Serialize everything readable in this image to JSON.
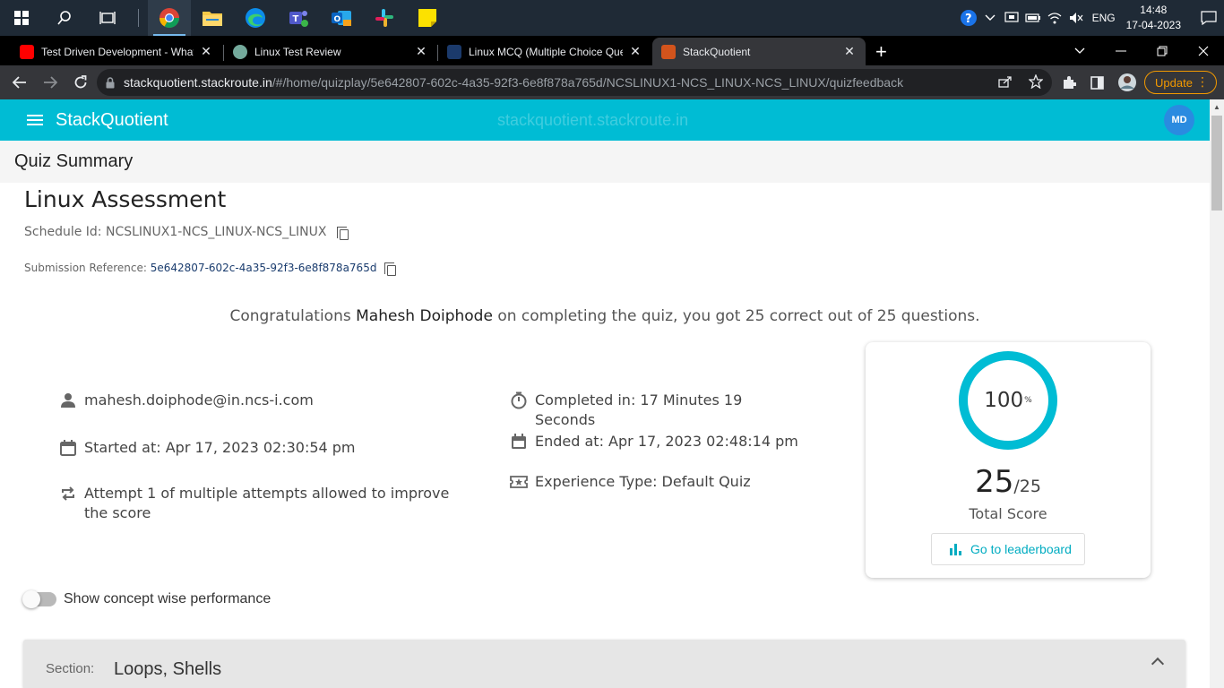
{
  "taskbar": {
    "apps": [
      "chrome",
      "file-explorer",
      "edge",
      "teams",
      "outlook",
      "slack",
      "sticky-notes"
    ],
    "tray": {
      "language": "ENG",
      "time": "14:48",
      "date": "17-04-2023"
    }
  },
  "browser": {
    "tabs": [
      {
        "title": "Test Driven Development - What",
        "icon": "youtube-icon",
        "active": false
      },
      {
        "title": "Linux Test Review",
        "icon": "chatgpt-icon",
        "active": false
      },
      {
        "title": "Linux MCQ (Multiple Choice Que",
        "icon": "sanfoundry-icon",
        "active": false
      },
      {
        "title": "StackQuotient",
        "icon": "stackquotient-icon",
        "active": true
      }
    ],
    "url_host": "stackquotient.stackroute.in",
    "url_path": "/#/home/quizplay/5e642807-602c-4a35-92f3-6e8f878a765d/NCSLINUX1-NCS_LINUX-NCS_LINUX/quizfeedback",
    "update_label": "Update"
  },
  "app": {
    "brand": "StackQuotient",
    "watermark": "stackquotient.stackroute.in",
    "avatar": "MD",
    "accent": "#00bcd4"
  },
  "page": {
    "subheader": "Quiz Summary",
    "title": "Linux Assessment",
    "schedule_label": "Schedule Id: ",
    "schedule_id": "NCSLINUX1-NCS_LINUX-NCS_LINUX",
    "submission_label": "Submission Reference: ",
    "submission_ref": "5e642807-602c-4a35-92f3-6e8f878a765d",
    "congrats_prefix": "Congratulations ",
    "user_name": "Mahesh Doiphode",
    "congrats_suffix": " on completing the quiz, you got 25 correct out of 25 questions."
  },
  "details": {
    "email": "mahesh.doiphode@in.ncs-i.com",
    "started": "Started at: Apr 17, 2023 02:30:54 pm",
    "attempt": "Attempt 1 of multiple attempts allowed to improve the score",
    "completed": "Completed in: 17 Minutes 19 Seconds",
    "ended": "Ended at: Apr 17, 2023 02:48:14 pm",
    "experience": "Experience Type: Default Quiz"
  },
  "score": {
    "percent": "100",
    "percent_sign": "%",
    "correct": "25",
    "total": "/25",
    "label": "Total Score",
    "leaderboard_button": "Go to leaderboard"
  },
  "toggle": {
    "label": "Show concept wise performance",
    "on": false
  },
  "section": {
    "key": "Section:",
    "value": "Loops, Shells"
  }
}
